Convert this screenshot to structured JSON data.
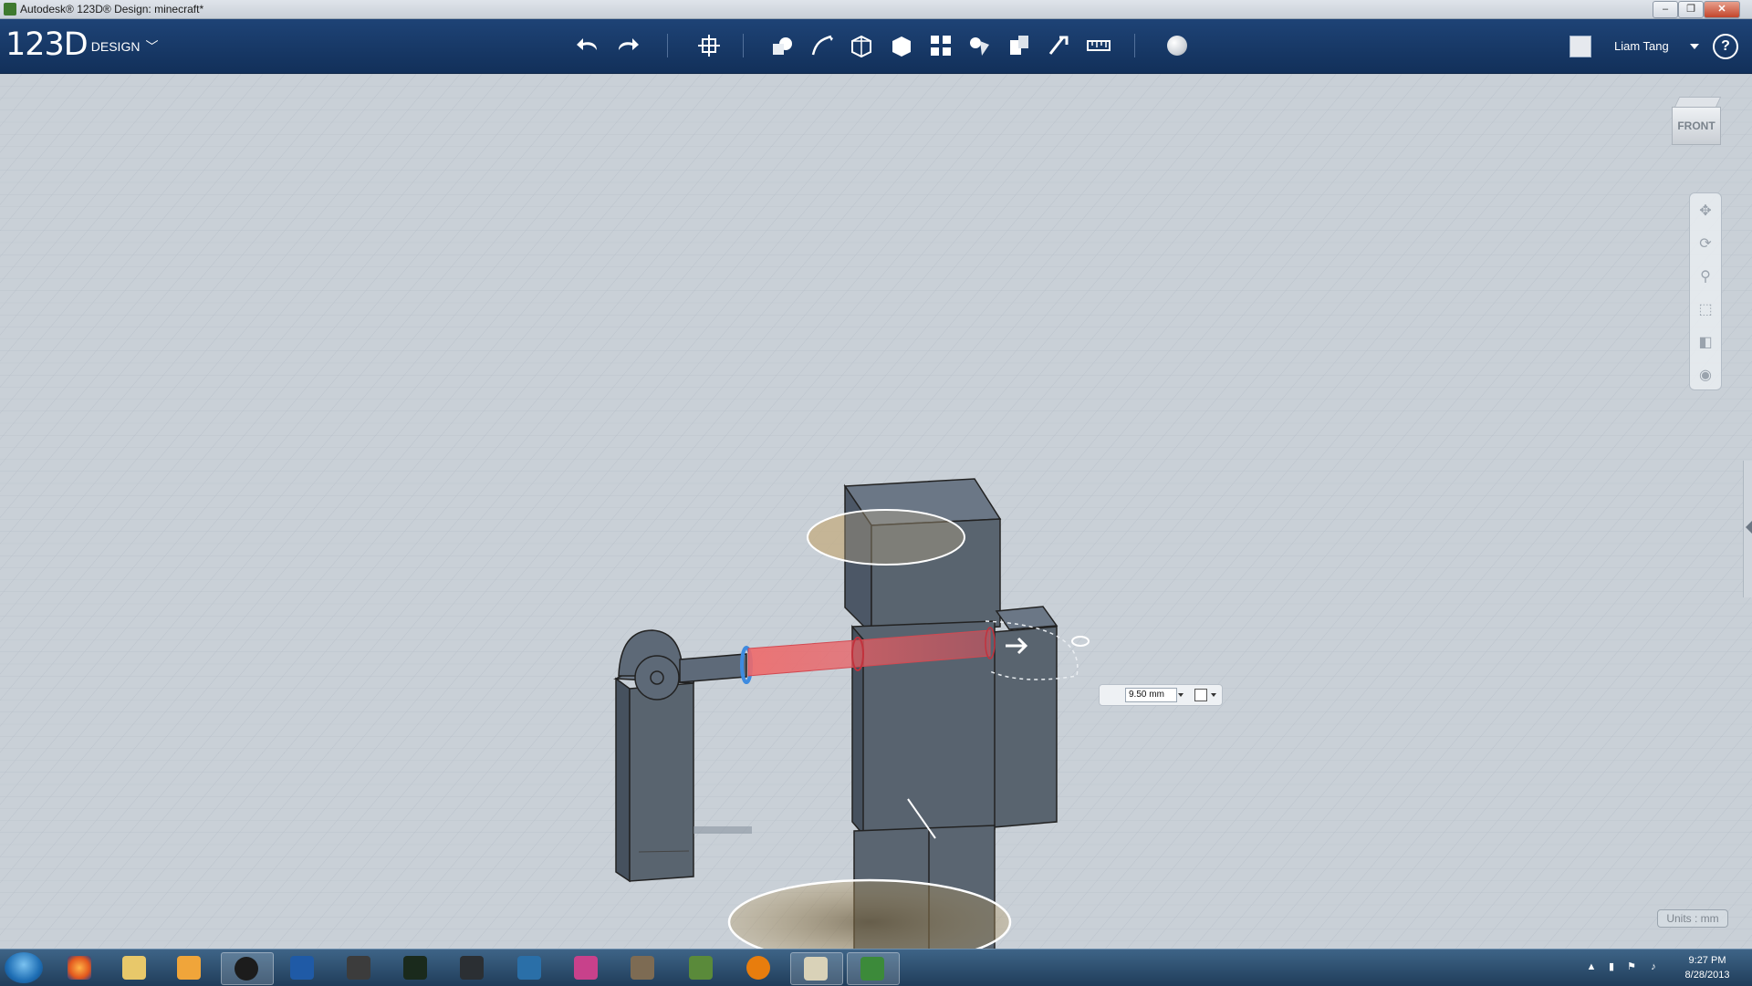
{
  "window": {
    "title": "Autodesk® 123D® Design: minecraft*",
    "buttons": [
      "–",
      "❐",
      "✕"
    ]
  },
  "toolbar": {
    "logo_main": "123D",
    "logo_sub": "DESIGN",
    "logo_menu_icon": "chevron-down-icon",
    "tools": [
      {
        "name": "undo-icon"
      },
      {
        "name": "redo-icon"
      },
      {
        "name": "transform-icon"
      },
      {
        "name": "primitives-icon"
      },
      {
        "name": "sketch-icon"
      },
      {
        "name": "construct-icon"
      },
      {
        "name": "modify-icon"
      },
      {
        "name": "pattern-icon"
      },
      {
        "name": "grouping-icon"
      },
      {
        "name": "combine-icon"
      },
      {
        "name": "snap-icon"
      },
      {
        "name": "measure-icon"
      },
      {
        "name": "material-icon"
      }
    ],
    "user_name": "Liam Tang",
    "help_label": "?"
  },
  "viewport": {
    "viewcube_label": "FRONT",
    "nav_tools": [
      "pan-icon",
      "orbit-icon",
      "zoom-icon",
      "fit-icon",
      "view-mode-icon",
      "visibility-icon"
    ],
    "dimension_value": "9.50 mm",
    "units_label": "Units : mm"
  },
  "taskbar": {
    "apps": [
      "firefox-icon",
      "explorer-icon",
      "media-player-icon",
      "hp-icon",
      "tasks-icon",
      "inkscape-icon",
      "sketchbook-icon",
      "pen-icon",
      "butterfly-icon",
      "paint-icon",
      "gimp-icon",
      "minecraft-icon",
      "blender-icon",
      "paint-palette-icon",
      "123d-icon"
    ],
    "time": "9:27 PM",
    "date": "8/28/2013"
  },
  "colors": {
    "toolbar_bg": "#1a3a68",
    "viewport_bg": "#c9d0d7",
    "model_fill": "#566272",
    "extrude_highlight": "#e8575a",
    "selection_ring": "#3e8be0"
  }
}
